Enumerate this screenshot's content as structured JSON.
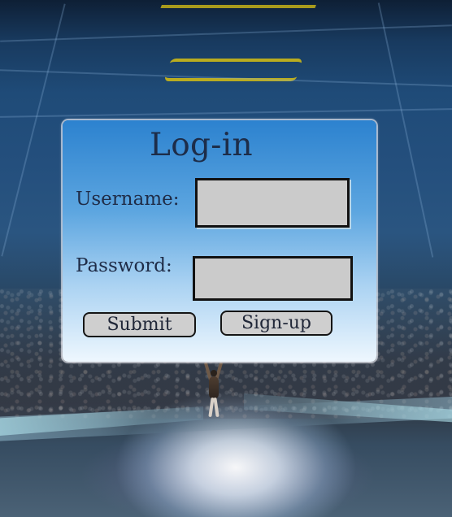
{
  "login_form": {
    "title": "Log-in",
    "username_label": "Username:",
    "password_label": "Password:",
    "username_value": "",
    "password_value": "",
    "submit_label": "Submit",
    "signup_label": "Sign-up"
  },
  "colors": {
    "panel_top": "#2c82cf",
    "panel_bottom": "#eef7fe",
    "text_dark": "#1d2d49",
    "input_fill": "#cbcbcb",
    "button_fill": "#cfcfcf",
    "border_dark": "#111111"
  },
  "icons": {
    "background": "stadium-concert-scene"
  }
}
